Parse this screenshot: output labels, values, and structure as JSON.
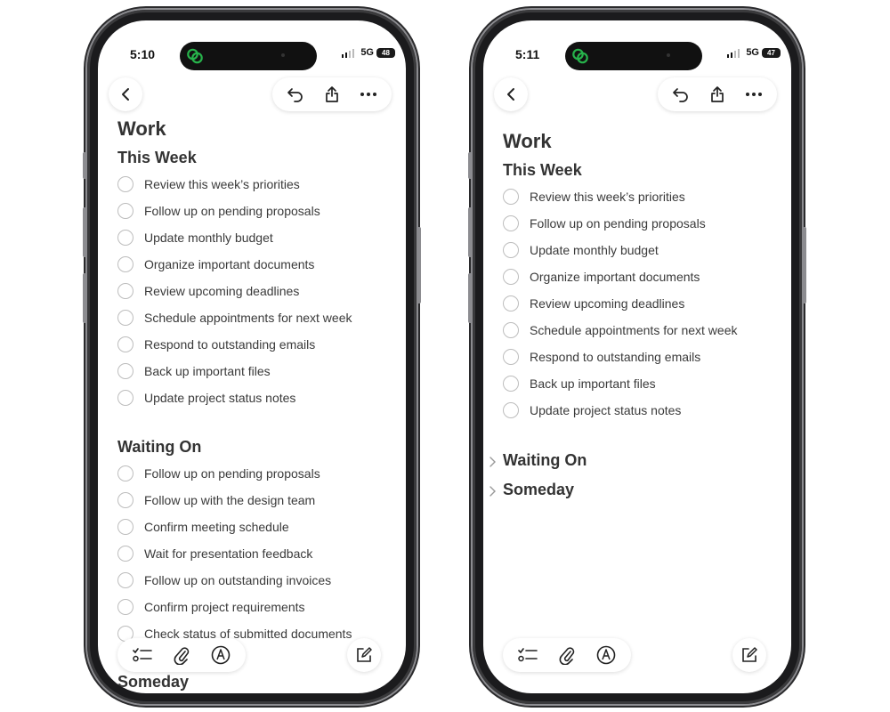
{
  "left": {
    "status": {
      "time": "5:10",
      "network": "5G",
      "battery": "48"
    },
    "note": {
      "title": "Work",
      "sections": [
        {
          "heading": "This Week",
          "items": [
            "Review this week’s priorities",
            "Follow up on pending proposals",
            "Update monthly budget",
            "Organize important documents",
            "Review upcoming deadlines",
            "Schedule appointments for next week",
            "Respond to outstanding emails",
            "Back up important files",
            "Update project status notes"
          ]
        },
        {
          "heading": "Waiting On",
          "items": [
            "Follow up on pending proposals",
            "Follow up with the design team",
            "Confirm meeting schedule",
            "Wait for presentation feedback",
            "Follow up on outstanding invoices",
            "Confirm project requirements",
            "Check status of submitted documents"
          ]
        },
        {
          "heading": "Someday",
          "items": []
        }
      ]
    }
  },
  "right": {
    "status": {
      "time": "5:11",
      "network": "5G",
      "battery": "47"
    },
    "note": {
      "title": "Work",
      "sections": [
        {
          "heading": "This Week",
          "items": [
            "Review this week’s priorities",
            "Follow up on pending proposals",
            "Update monthly budget",
            "Organize important documents",
            "Review upcoming deadlines",
            "Schedule appointments for next week",
            "Respond to outstanding emails",
            "Back up important files",
            "Update project status notes"
          ]
        }
      ],
      "collapsed_sections": [
        "Waiting On",
        "Someday"
      ]
    }
  },
  "icons": {
    "back": "chevron-left-icon",
    "undo": "undo-icon",
    "share": "share-icon",
    "more": "more-icon",
    "checklist": "checklist-icon",
    "attach": "paperclip-icon",
    "markup": "markup-pen-icon",
    "compose": "compose-icon"
  },
  "colors": {
    "app_icon": "#27b34b"
  }
}
